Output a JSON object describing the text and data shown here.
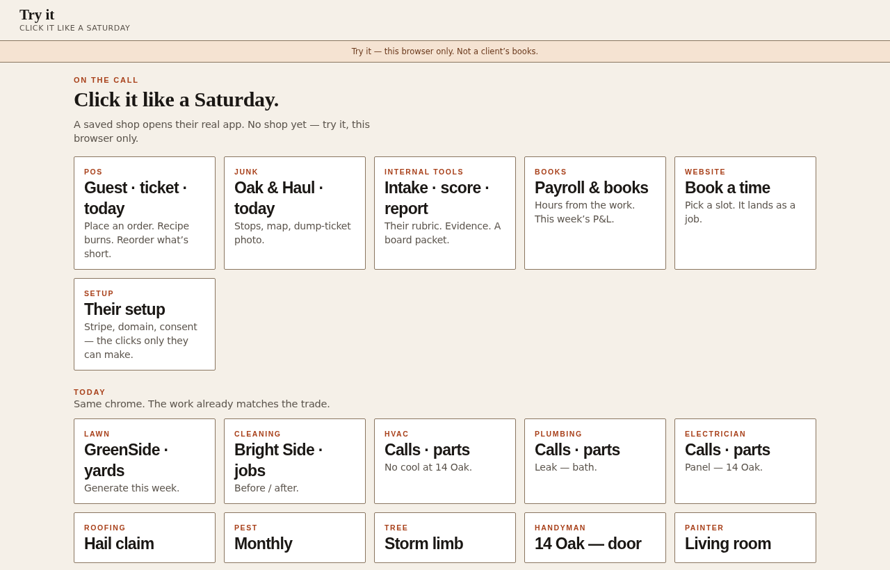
{
  "header": {
    "title": "Try it",
    "subtitle": "CLICK IT LIKE A SATURDAY"
  },
  "banner": "Try it — this browser only. Not a client’s books.",
  "sections": [
    {
      "eyebrow": "ON THE CALL",
      "heading": "Click it like a Saturday.",
      "intro": "A saved shop opens their real app. No shop yet — try it, this browser only.",
      "cards": [
        {
          "tag": "POS",
          "title": "Guest · ticket · today",
          "body": "Place an order. Recipe burns. Reorder what’s short."
        },
        {
          "tag": "JUNK",
          "title": "Oak & Haul · today",
          "body": "Stops, map, dump-ticket photo."
        },
        {
          "tag": "INTERNAL TOOLS",
          "title": "Intake · score · report",
          "body": "Their rubric. Evidence. A board packet."
        },
        {
          "tag": "BOOKS",
          "title": "Payroll & books",
          "body": "Hours from the work. This week’s P&L."
        },
        {
          "tag": "WEBSITE",
          "title": "Book a time",
          "body": "Pick a slot. It lands as a job."
        },
        {
          "tag": "SETUP",
          "title": "Their setup",
          "body": "Stripe, domain, consent — the clicks only they can make."
        }
      ]
    },
    {
      "eyebrow": "TODAY",
      "intro": "Same chrome. The work already matches the trade.",
      "cards": [
        {
          "tag": "LAWN",
          "title": "GreenSide · yards",
          "body": "Generate this week."
        },
        {
          "tag": "CLEANING",
          "title": "Bright Side · jobs",
          "body": "Before / after."
        },
        {
          "tag": "HVAC",
          "title": "Calls · parts",
          "body": "No cool at 14 Oak."
        },
        {
          "tag": "PLUMBING",
          "title": "Calls · parts",
          "body": "Leak — bath."
        },
        {
          "tag": "ELECTRICIAN",
          "title": "Calls · parts",
          "body": "Panel — 14 Oak."
        },
        {
          "tag": "ROOFING",
          "title": "Hail claim"
        },
        {
          "tag": "PEST",
          "title": "Monthly"
        },
        {
          "tag": "TREE",
          "title": "Storm limb"
        },
        {
          "tag": "HANDYMAN",
          "title": "14 Oak — door"
        },
        {
          "tag": "PAINTER",
          "title": "Living room"
        }
      ]
    }
  ]
}
